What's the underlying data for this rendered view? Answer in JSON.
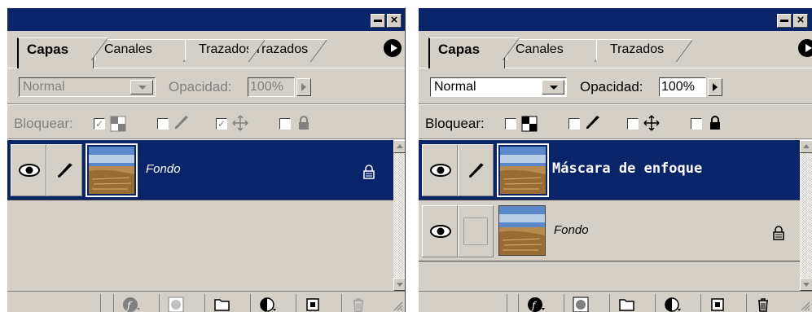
{
  "panels": [
    {
      "tabs": {
        "active": "Capas",
        "second": "Canales",
        "third": "Trazados"
      },
      "blend_mode": "Normal",
      "opacity_label": "Opacidad:",
      "opacity_value": "100%",
      "lock_label": "Bloquear:",
      "layers": [
        {
          "name": "Fondo",
          "selected": true,
          "locked": true
        }
      ]
    },
    {
      "tabs": {
        "active": "Capas",
        "second": "Canales",
        "third": "Trazados"
      },
      "blend_mode": "Normal",
      "opacity_label": "Opacidad:",
      "opacity_value": "100%",
      "lock_label": "Bloquear:",
      "layers": [
        {
          "name": "Máscara de enfoque",
          "selected": true,
          "locked": false
        },
        {
          "name": "Fondo",
          "selected": false,
          "locked": true
        }
      ]
    }
  ],
  "colors": {
    "title_bar": "#0a246a",
    "panel_bg": "#d4d0c8",
    "selection": "#0a246a"
  },
  "icons": {
    "eye": "eye-icon",
    "brush": "brush-icon",
    "lock": "lock-icon",
    "move": "move-icon",
    "transparency": "transparency-icon",
    "layer_style": "layer-style-icon",
    "mask": "mask-icon",
    "folder": "folder-icon",
    "adjustment": "adjustment-icon",
    "new_layer": "new-layer-icon",
    "trash": "trash-icon"
  }
}
